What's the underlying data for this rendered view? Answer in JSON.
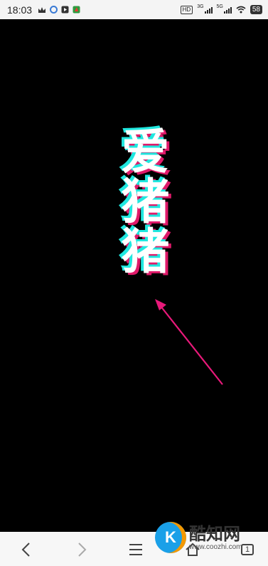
{
  "status_bar": {
    "time": "18:03",
    "hd_label": "HD",
    "net1_label": "3G",
    "net2_label": "5G",
    "battery": "58"
  },
  "content": {
    "vertical_text": "爱猪猪",
    "arrow_color": "#e8197a"
  },
  "watermark": {
    "logo_letter": "K",
    "name": "酷知网",
    "url": "www.coozhi.com"
  },
  "nav": {
    "back_icon": "chevron-left-icon",
    "forward_icon": "chevron-right-icon",
    "menu_icon": "menu-icon",
    "home_icon": "home-icon",
    "tabs_count": "1"
  }
}
